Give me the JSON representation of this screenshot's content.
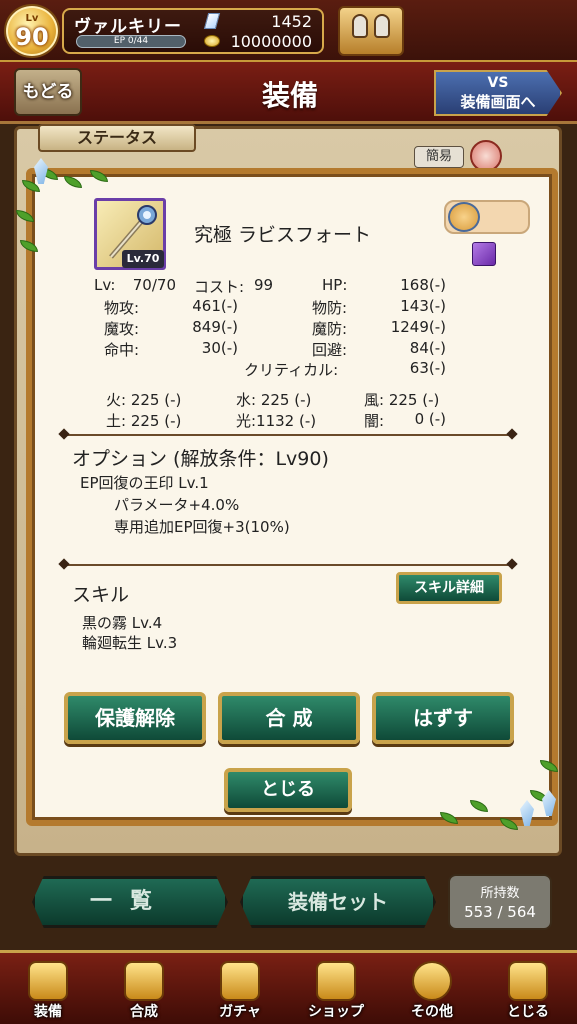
{
  "topbar": {
    "level_prefix": "Lv",
    "level": "90",
    "player_name": "ヴァルキリー",
    "ep_text": "EP 0/44",
    "gems": "1452",
    "gold": "10000000"
  },
  "header": {
    "back_label": "もどる",
    "title": "装備",
    "vs_line1": "VS",
    "vs_line2": "装備画面へ"
  },
  "status_tab": "ステータス",
  "simple_label": "簡易",
  "item": {
    "thumb_level": "Lv.70",
    "name": "究極 ラビスフォート"
  },
  "stats": {
    "lv_label": "Lv:",
    "lv_value": "70/70",
    "cost_label": "コスト:",
    "cost_value": "99",
    "hp_label": "HP:",
    "hp_value": "168(-)",
    "patk_label": "物攻:",
    "patk_value": "461(-)",
    "pdef_label": "物防:",
    "pdef_value": "143(-)",
    "matk_label": "魔攻:",
    "matk_value": "849(-)",
    "mdef_label": "魔防:",
    "mdef_value": "1249(-)",
    "acc_label": "命中:",
    "acc_value": "30(-)",
    "eva_label": "回避:",
    "eva_value": "84(-)",
    "crit_label": "クリティカル:",
    "crit_value": "63(-)"
  },
  "elements": {
    "fire": "火: 225 (-)",
    "water": "水: 225 (-)",
    "wind": "風: 225 (-)",
    "earth": "土: 225 (-)",
    "light": "光:1132 (-)",
    "dark_label": "闇:",
    "dark_value": "0 (-)"
  },
  "option": {
    "header": "オプション (解放条件：Lv90)",
    "line1": "EP回復の王印 Lv.1",
    "line2": "パラメータ+4.0%",
    "line3": "専用追加EP回復+3(10%)"
  },
  "skill": {
    "header": "スキル",
    "detail_button": "スキル詳細",
    "skill1": "黒の霧 Lv.4",
    "skill2": "輪廻転生 Lv.3"
  },
  "buttons": {
    "protect": "保護解除",
    "synth": "合 成",
    "remove": "はずす",
    "close": "とじる"
  },
  "lower": {
    "list": "一覧",
    "equip_set": "装備セット",
    "owned_label": "所持数",
    "owned_value": "553 / 564"
  },
  "nav": {
    "equip": "装備",
    "synth": "合成",
    "gacha": "ガチャ",
    "shop": "ショップ",
    "other": "その他",
    "close": "とじる"
  }
}
